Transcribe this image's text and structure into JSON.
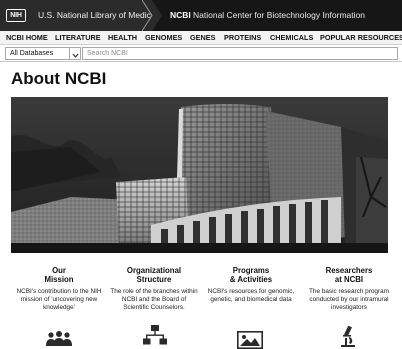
{
  "agency_bar": {
    "nih_badge": "NIH",
    "nlm_label": "U.S. National Library of Medicine",
    "ncbi_short": "NCBI",
    "ncbi_full": "National Center for Biotechnology Information"
  },
  "main_nav": {
    "items": [
      "NCBI HOME",
      "LITERATURE",
      "HEALTH",
      "GENOMES",
      "GENES",
      "PROTEINS",
      "CHEMICALS",
      "POPULAR RESOURCES ▼"
    ]
  },
  "search": {
    "database_selected": "All Databases",
    "placeholder": "Search NCBI"
  },
  "page": {
    "title": "About NCBI"
  },
  "features": [
    {
      "title_line1": "Our",
      "title_line2": "Mission",
      "description": "NCBI's contribution to the NIH mission of 'uncovering new knowledge'",
      "icon": "people-icon"
    },
    {
      "title_line1": "Organizational",
      "title_line2": "Structure",
      "description": "The role of the branches within NCBI and the Board of Scientific Counselors.",
      "icon": "org-chart-icon"
    },
    {
      "title_line1": "Programs",
      "title_line2": "& Activities",
      "description": "NCBI's resources for genomic, genetic, and biomedical data",
      "icon": "image-icon"
    },
    {
      "title_line1": "Researchers",
      "title_line2": "at NCBI",
      "description": "The basic research program conducted by our intramural investigators",
      "icon": "microscope-icon"
    }
  ],
  "colors": {
    "agency_bar": "#2b2b2b",
    "ncbi_tab": "#161616",
    "nav_background": "#f3f3f3",
    "text": "#111111"
  }
}
